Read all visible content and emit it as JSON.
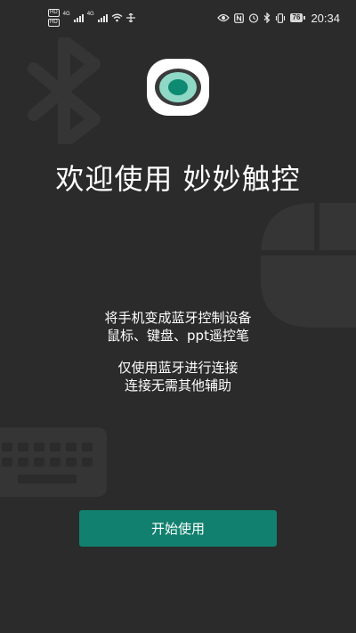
{
  "status_bar": {
    "sim1": "HD",
    "sim2": "HD",
    "net1": "4G",
    "net2": "4G",
    "battery": "76",
    "time": "20:34"
  },
  "welcome": {
    "title": "欢迎使用 妙妙触控",
    "lines": [
      "将手机变成蓝牙控制设备",
      "鼠标、键盘、ppt遥控笔",
      "仅使用蓝牙进行连接",
      "连接无需其他辅助"
    ],
    "start_button": "开始使用"
  },
  "colors": {
    "background": "#2b2b2b",
    "accent": "#11806e",
    "logo_ring": "#8fd8c6",
    "logo_center": "#0f8a72"
  }
}
